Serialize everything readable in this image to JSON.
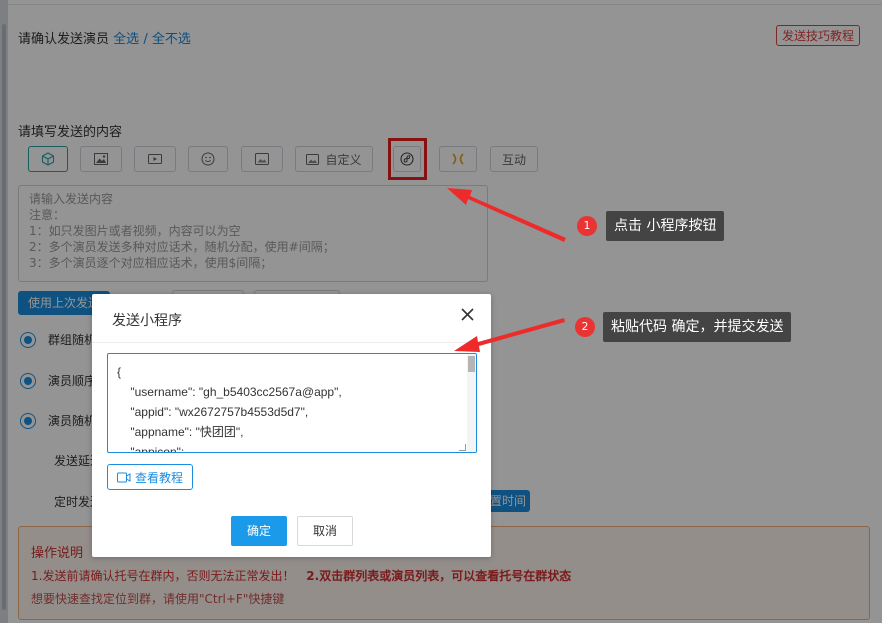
{
  "header": {
    "confirm_label": "请确认发送演员",
    "select_all": "全选",
    "separator": "/",
    "select_none": "全不选",
    "tips_button": "发送技巧教程"
  },
  "content": {
    "label": "请填写发送的内容",
    "toolbar": {
      "icons": [
        "cube-icon",
        "image-icon",
        "video-icon",
        "emoji-icon",
        "photo-icon",
        "custom-icon",
        "mini-program-icon",
        "link-icon"
      ],
      "custom_label": "自定义",
      "interact_label": "互动"
    },
    "textarea_placeholder": "请输入发送内容\n注意：\n1：如只发图片或者视频，内容可以为空\n2：多个演员发送多种对应话术，随机分配，使用#间隔；\n3：多个演员逐个对应相应话术，使用$间隔；",
    "use_last_button": "使用上次发送"
  },
  "options": {
    "radio1": "群组随机",
    "radio2": "演员顺序",
    "radio3": "演员随机",
    "delay_label": "发送延迟",
    "schedule_label": "定时发送",
    "set_time_button": "置时间"
  },
  "instructions": {
    "title": "操作说明",
    "line1_part1": "1.发送前请确认托号在群内，否则无法正常发出！",
    "line1_part2": "2.双击群列表或演员列表，可以查看托号在群状态",
    "line2": "想要快速查找定位到群，请使用\"Ctrl+F\"快捷键"
  },
  "dialog": {
    "title": "发送小程序",
    "code": "{\n    \"username\": \"gh_b5403cc2567a@app\",\n    \"appid\": \"wx2672757b4553d5d7\",\n    \"appname\": \"快团团\",\n    \"appicon\":",
    "tutorial_button": "查看教程",
    "ok_button": "确定",
    "cancel_button": "取消"
  },
  "annotations": {
    "step1_number": "1",
    "step1_text": "点击 小程序按钮",
    "step2_number": "2",
    "step2_text": "粘贴代码  确定，并提交发送"
  },
  "colors": {
    "primary": "#1a8de0",
    "danger": "#e81e1e",
    "callout_bg": "#444444"
  }
}
